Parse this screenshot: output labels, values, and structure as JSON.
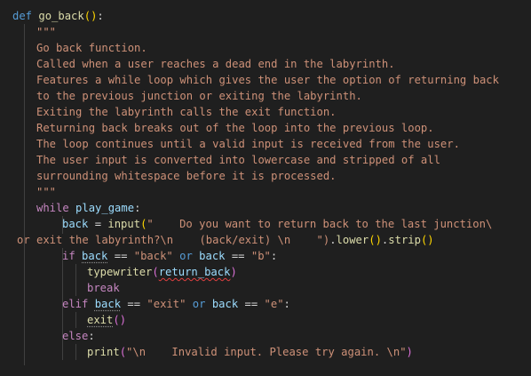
{
  "lines": {
    "l1": {
      "kw": "def",
      "name": "go_back",
      "open": "(",
      "close": ")",
      "colon": ":"
    },
    "l2": {
      "text": "\"\"\""
    },
    "l3": {
      "text": "Go back function."
    },
    "l4": {
      "text": "Called when a user reaches a dead end in the labyrinth."
    },
    "l5": {
      "text": "Features a while loop which gives the user the option of returning back"
    },
    "l6": {
      "text": "to the previous junction or exiting the labyrinth."
    },
    "l7": {
      "text": "Exiting the labyrinth calls the exit function."
    },
    "l8": {
      "text": "Returning back breaks out of the loop into the previous loop."
    },
    "l9": {
      "text": "The loop continues until a valid input is received from the user."
    },
    "l10": {
      "text": "The user input is converted into lowercase and stripped of all"
    },
    "l11": {
      "text": "surrounding whitespace before it is processed."
    },
    "l12": {
      "text": "\"\"\""
    },
    "l13": {
      "kw": "while",
      "name": "play_game",
      "colon": ":"
    },
    "l14": {
      "var": "back",
      "eq": " = ",
      "fn": "input",
      "open": "(",
      "str": "\"    Do you want to return back to the last junction\\"
    },
    "l15": {
      "str": "or exit the labyrinth?\\n    (back/exit) \\n    \")",
      "dot1": ".",
      "fn1": "lower",
      "p1": "()",
      "dot2": ".",
      "fn2": "strip",
      "p2": "()"
    },
    "l16": {
      "kw": "if",
      "var1": "back",
      "op1": " == ",
      "s1": "\"back\"",
      "or": " or ",
      "var2": "back",
      "op2": " == ",
      "s2": "\"b\"",
      "colon": ":"
    },
    "l17": {
      "fn": "typewriter",
      "open": "(",
      "arg": "return_back",
      "close": ")"
    },
    "l18": {
      "kw": "break"
    },
    "l19": {
      "kw": "elif",
      "var1": "back",
      "op1": " == ",
      "s1": "\"exit\"",
      "or": " or ",
      "var2": "back",
      "op2": " == ",
      "s2": "\"e\"",
      "colon": ":"
    },
    "l20": {
      "fn": "exit",
      "p": "()"
    },
    "l21": {
      "kw": "else",
      "colon": ":"
    },
    "l22": {
      "fn": "print",
      "open": "(",
      "str": "\"\\n    Invalid input. Please try again. \\n\"",
      "close": ")"
    }
  }
}
